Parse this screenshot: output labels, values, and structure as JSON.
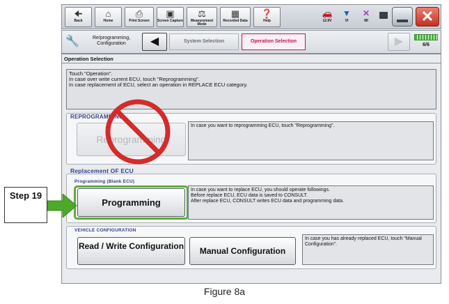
{
  "toolbar": {
    "buttons": [
      {
        "label": "Back",
        "icon": "back-arrow-icon"
      },
      {
        "label": "Home",
        "icon": "home-icon"
      },
      {
        "label": "Print Screen",
        "icon": "printer-icon"
      },
      {
        "label": "Screen Capture",
        "icon": "camera-icon"
      },
      {
        "label": "Measurement Mode",
        "icon": "measurement-icon"
      },
      {
        "label": "Recorded Data",
        "icon": "recorded-data-icon"
      },
      {
        "label": "Help",
        "icon": "help-icon"
      }
    ],
    "status": [
      {
        "label": "12.9V",
        "icon": "car-battery-icon"
      },
      {
        "label": "VI",
        "icon": "signal-icon"
      },
      {
        "label": "MI",
        "icon": "mi-disconnected-icon"
      }
    ]
  },
  "nav": {
    "section_label": "Re/programming, Configuration",
    "steps": [
      "System Selection",
      "Operation Selection"
    ],
    "page_count": "6/6"
  },
  "page_title": "Operation Selection",
  "instructions": [
    "Touch \"Operation\".",
    "In case over write current ECU, touch \"Reprogramming\".",
    "In case replacement of ECU, select an operation in REPLACE ECU category."
  ],
  "reprogramming": {
    "heading": "REPROGRAMMING",
    "button": "Reprogramming",
    "description": "In case you want to reprogramming ECU, touch \"Reprogramming\"."
  },
  "replacement": {
    "heading": "Replacement OF ECU",
    "programming_label": "Programming (Blank ECU)",
    "programming_button": "Programming",
    "programming_description": [
      "In case you want to replace ECU, you should operate followings.",
      "Before replace ECU, ECU data is saved to CONSULT.",
      "After replace ECU, CONSULT writes ECU data and programming data."
    ],
    "vehicle_config_label": "VEHICLE CONFIGURATION",
    "read_write_button": "Read / Write Configuration",
    "manual_button": "Manual Configuration",
    "manual_description": "In case you has already replaced ECU, touch \"Manual Configuration\"."
  },
  "callout": "Step 19",
  "caption": "Figure 8a",
  "colors": {
    "accent_red": "#d42b2b",
    "highlight_green": "#5aaf3c",
    "arrow_green": "#4ea829",
    "heading_blue": "#33418c"
  }
}
